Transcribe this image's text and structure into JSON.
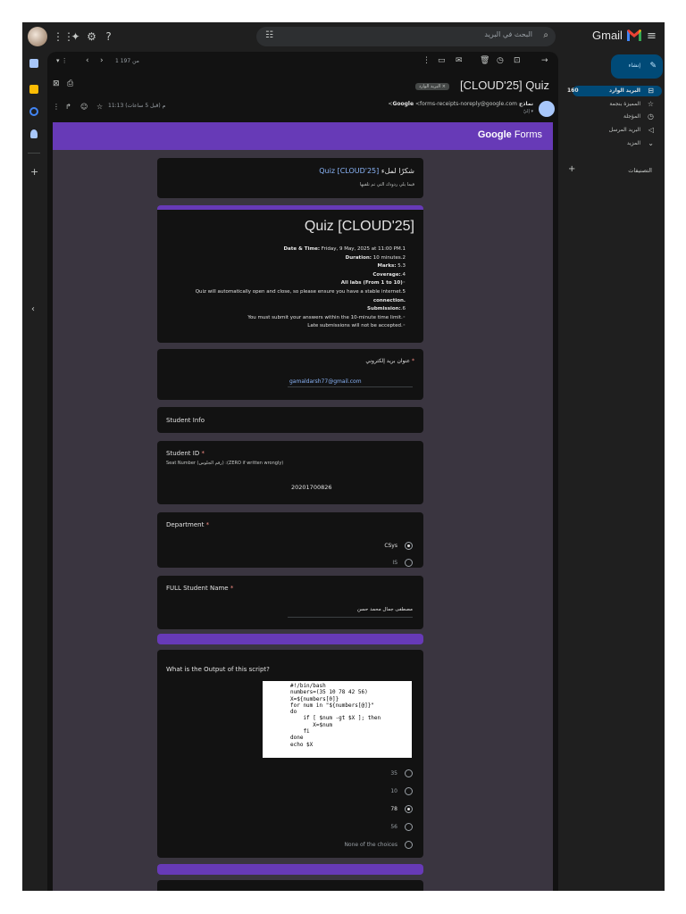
{
  "topbar": {
    "search_placeholder": "البحث في البريد",
    "brand": "Gmail"
  },
  "reader": {
    "pager": "1 من 197",
    "subject": "[CLOUD'25] Quiz",
    "chip": "البريد الوارد ×",
    "sender_name": "نماذج Google",
    "sender_email": "<forms-receipts-noreply@google.com>",
    "to": "إليّ ▾",
    "time": "11:13 م (قبل 5 ساعات)"
  },
  "forms": {
    "logo_google": "Google",
    "logo_forms": "Forms",
    "thanks_prefix": "شكرًا لملء",
    "thanks_quiz": "Quiz [CLOUD'25]",
    "thanks_sub": "فيما يلي ردودك التي تم تلقيها",
    "title": "Quiz [CLOUD'25]",
    "info": [
      {
        "pre": ".1 ",
        "bold": "Date & Time:",
        "post": " Friday, 9 May, 2025 at 11:00 PM"
      },
      {
        "pre": ".2 ",
        "bold": "Duration:",
        "post": " 10 minutes"
      },
      {
        "pre": ".3 ",
        "bold": "Marks:",
        "post": " 5"
      },
      {
        "pre": ".4 ",
        "bold": "Coverage:",
        "post": ""
      },
      {
        "pre": "◦ ",
        "bold": "All labs (From 1 to 10)",
        "post": ""
      },
      {
        "pre": ".5 ",
        "bold": "",
        "post": "Quiz will automatically open and close, so please ensure you have a stable internet"
      },
      {
        "pre": "",
        "bold": "connection.",
        "post": ""
      },
      {
        "pre": ".6 ",
        "bold": "Submission:",
        "post": ""
      },
      {
        "pre": "◦ ",
        "bold": "",
        "post": "You must submit your answers within the 10-minute time limit."
      },
      {
        "pre": "◦ ",
        "bold": "",
        "post": "Late submissions will not be accepted."
      }
    ],
    "email_label": "عنوان بريد إلكتروني",
    "email_value": "gamaldarsh77@gmail.com",
    "section_student_info": "Student Info",
    "student_id_label": "Student ID",
    "student_id_hint": "Seat Number (رقم الجلوس) :(ZERO if written wrongly)",
    "student_id_value": "20201700826",
    "department_label": "Department",
    "department_options": [
      {
        "label": "CSys",
        "checked": true
      },
      {
        "label": "IS",
        "checked": false
      }
    ],
    "fullname_label": "FULL Student Name",
    "fullname_value": "مصطفى جمال محمد حسن",
    "q1_label": "What is the Output of this script?",
    "code": "#!/bin/bash\nnumbers=(35 10 78 42 56)\nX=${numbers[0]}\nfor num in \"${numbers[@]}\"\ndo\n    if [ $num -gt $X ]; then\n       X=$num\n    fi\ndone\necho $X",
    "q1_options": [
      {
        "label": "35",
        "checked": false
      },
      {
        "label": "10",
        "checked": false
      },
      {
        "label": "78",
        "checked": true
      },
      {
        "label": "56",
        "checked": false
      },
      {
        "label": "None of the choices",
        "checked": false
      }
    ]
  },
  "nav": {
    "compose": "إنشاء",
    "inbox": "البريد الوارد",
    "inbox_count": "160",
    "starred": "المميزة بنجمة",
    "snoozed": "المؤجلة",
    "sent": "البريد المرسل",
    "more": "المزيد",
    "labels": "التصنيفات"
  },
  "colors": {
    "forms_purple": "#673ab7",
    "compose_bg": "#004a77",
    "accent_blue": "#a8c7fa"
  }
}
